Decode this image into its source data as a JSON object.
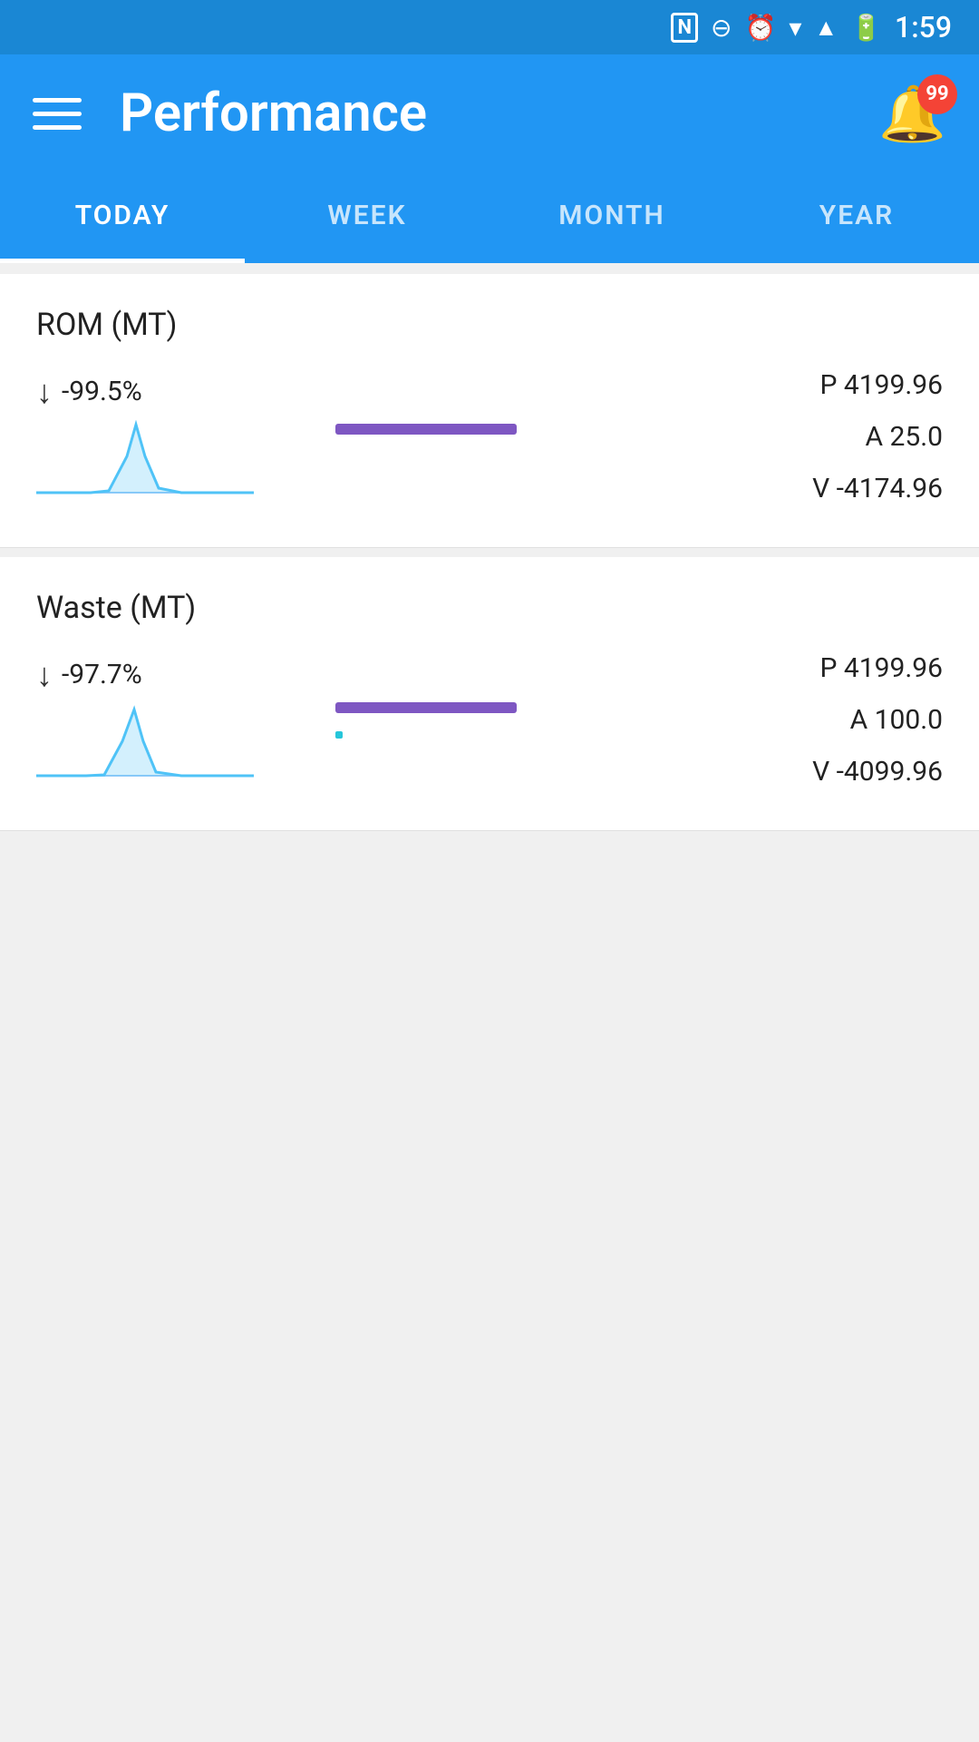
{
  "statusBar": {
    "time": "1:59"
  },
  "appBar": {
    "title": "Performance",
    "notificationCount": "99"
  },
  "tabs": [
    {
      "id": "today",
      "label": "TODAY",
      "active": true
    },
    {
      "id": "week",
      "label": "WEEK",
      "active": false
    },
    {
      "id": "month",
      "label": "MONTH",
      "active": false
    },
    {
      "id": "year",
      "label": "YEAR",
      "active": false
    }
  ],
  "cards": [
    {
      "id": "rom",
      "title": "ROM (MT)",
      "percent": "-99.5%",
      "p_label": "P",
      "p_value": "4199.96",
      "a_label": "A",
      "a_value": "25.0",
      "v_label": "V",
      "v_value": "-4174.96"
    },
    {
      "id": "waste",
      "title": "Waste (MT)",
      "percent": "-97.7%",
      "p_label": "P",
      "p_value": "4199.96",
      "a_label": "A",
      "a_value": "100.0",
      "v_label": "V",
      "v_value": "-4099.96"
    }
  ]
}
